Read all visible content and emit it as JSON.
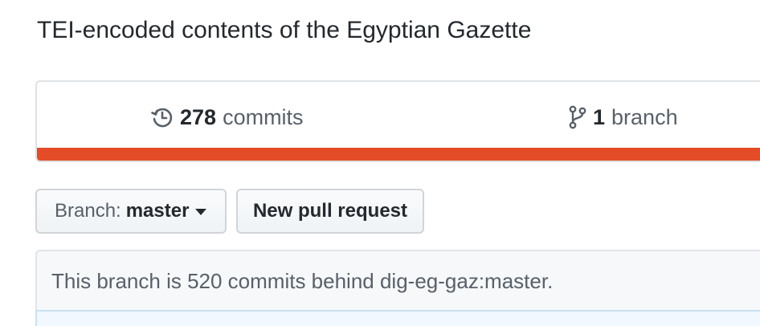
{
  "repo": {
    "description": "TEI-encoded contents of the Egyptian Gazette"
  },
  "summary": {
    "commits": {
      "count": "278",
      "label": "commits",
      "icon": "history-icon"
    },
    "branches": {
      "count": "1",
      "label": "branch",
      "icon": "git-branch-icon"
    },
    "language_color": "#e34c26"
  },
  "toolbar": {
    "branch_prefix": "Branch:",
    "branch_name": "master",
    "new_pr_label": "New pull request"
  },
  "branch_status": {
    "text": "This branch is 520 commits behind dig-eg-gaz:master."
  }
}
